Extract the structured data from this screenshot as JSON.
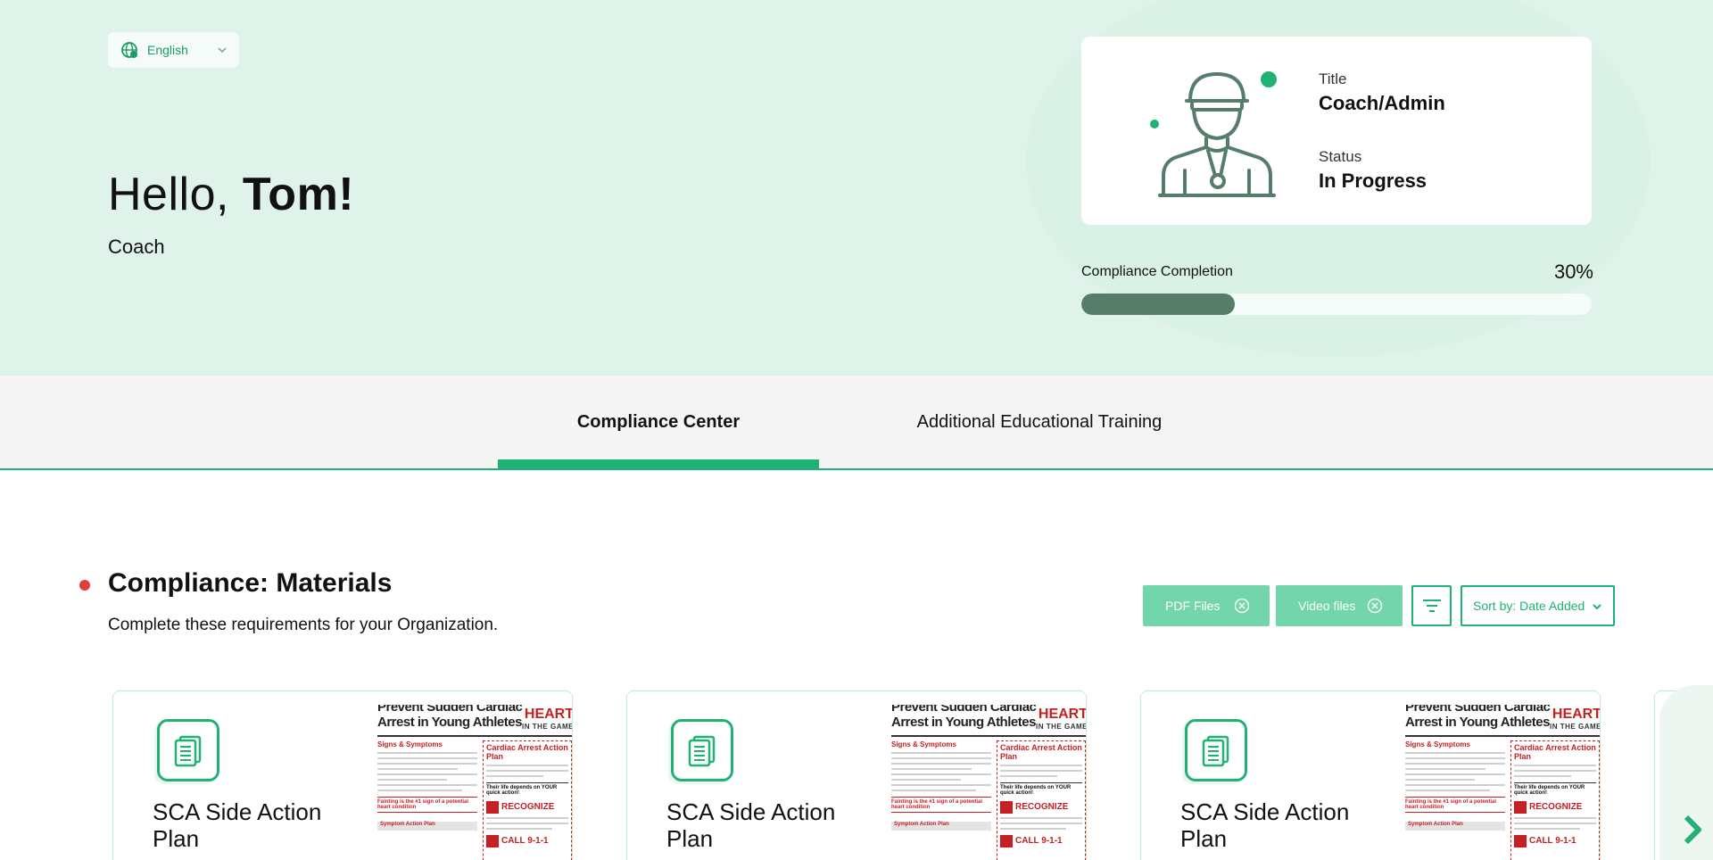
{
  "header": {
    "language": {
      "label": "English",
      "icon": "globe-chat-icon"
    },
    "greeting_prefix": "Hello, ",
    "user_name": "Tom!",
    "role": "Coach"
  },
  "profile_card": {
    "title_label": "Title",
    "title_value": "Coach/Admin",
    "status_label": "Status",
    "status_value": "In Progress",
    "illustration": "coach-with-whistle-illustration"
  },
  "compliance": {
    "label": "Compliance Completion",
    "percent_text": "30%",
    "percent": 30
  },
  "tabs": [
    {
      "label": "Compliance Center",
      "active": true
    },
    {
      "label": "Additional Educational Training",
      "active": false
    }
  ],
  "section": {
    "title": "Compliance: Materials",
    "subtitle": "Complete these requirements for your Organization."
  },
  "filters": {
    "chips": [
      {
        "label": "PDF Files"
      },
      {
        "label": "Video files"
      }
    ],
    "sort_label": "Sort by: Date Added"
  },
  "cards": [
    {
      "title": "SCA Side Action Plan"
    },
    {
      "title": "SCA Side Action Plan"
    },
    {
      "title": "SCA Side Action Plan"
    }
  ],
  "doc_preview": {
    "heading_line1": "Prevent Sudden Cardiac",
    "heading_line2": "Arrest in Young Athletes",
    "brand_line1": "HEART",
    "brand_line2": "IN THE GAME",
    "section_signs": "Signs & Symptoms",
    "fainting_note": "Fainting is the #1 sign of a potential heart condition",
    "symptom_plan": "Symptom Action Plan",
    "cardiac_plan": "Cardiac Arrest Action Plan",
    "life_depends": "Their life depends on YOUR quick action!",
    "recognize": "RECOGNIZE",
    "call": "CALL 9-1-1"
  },
  "colors": {
    "accent": "#1fb274",
    "hero_bg": "#e0f3ea",
    "progress_fill": "#567d6a",
    "chip_bg": "#72d5ac",
    "alert_dot": "#e23d3d"
  }
}
